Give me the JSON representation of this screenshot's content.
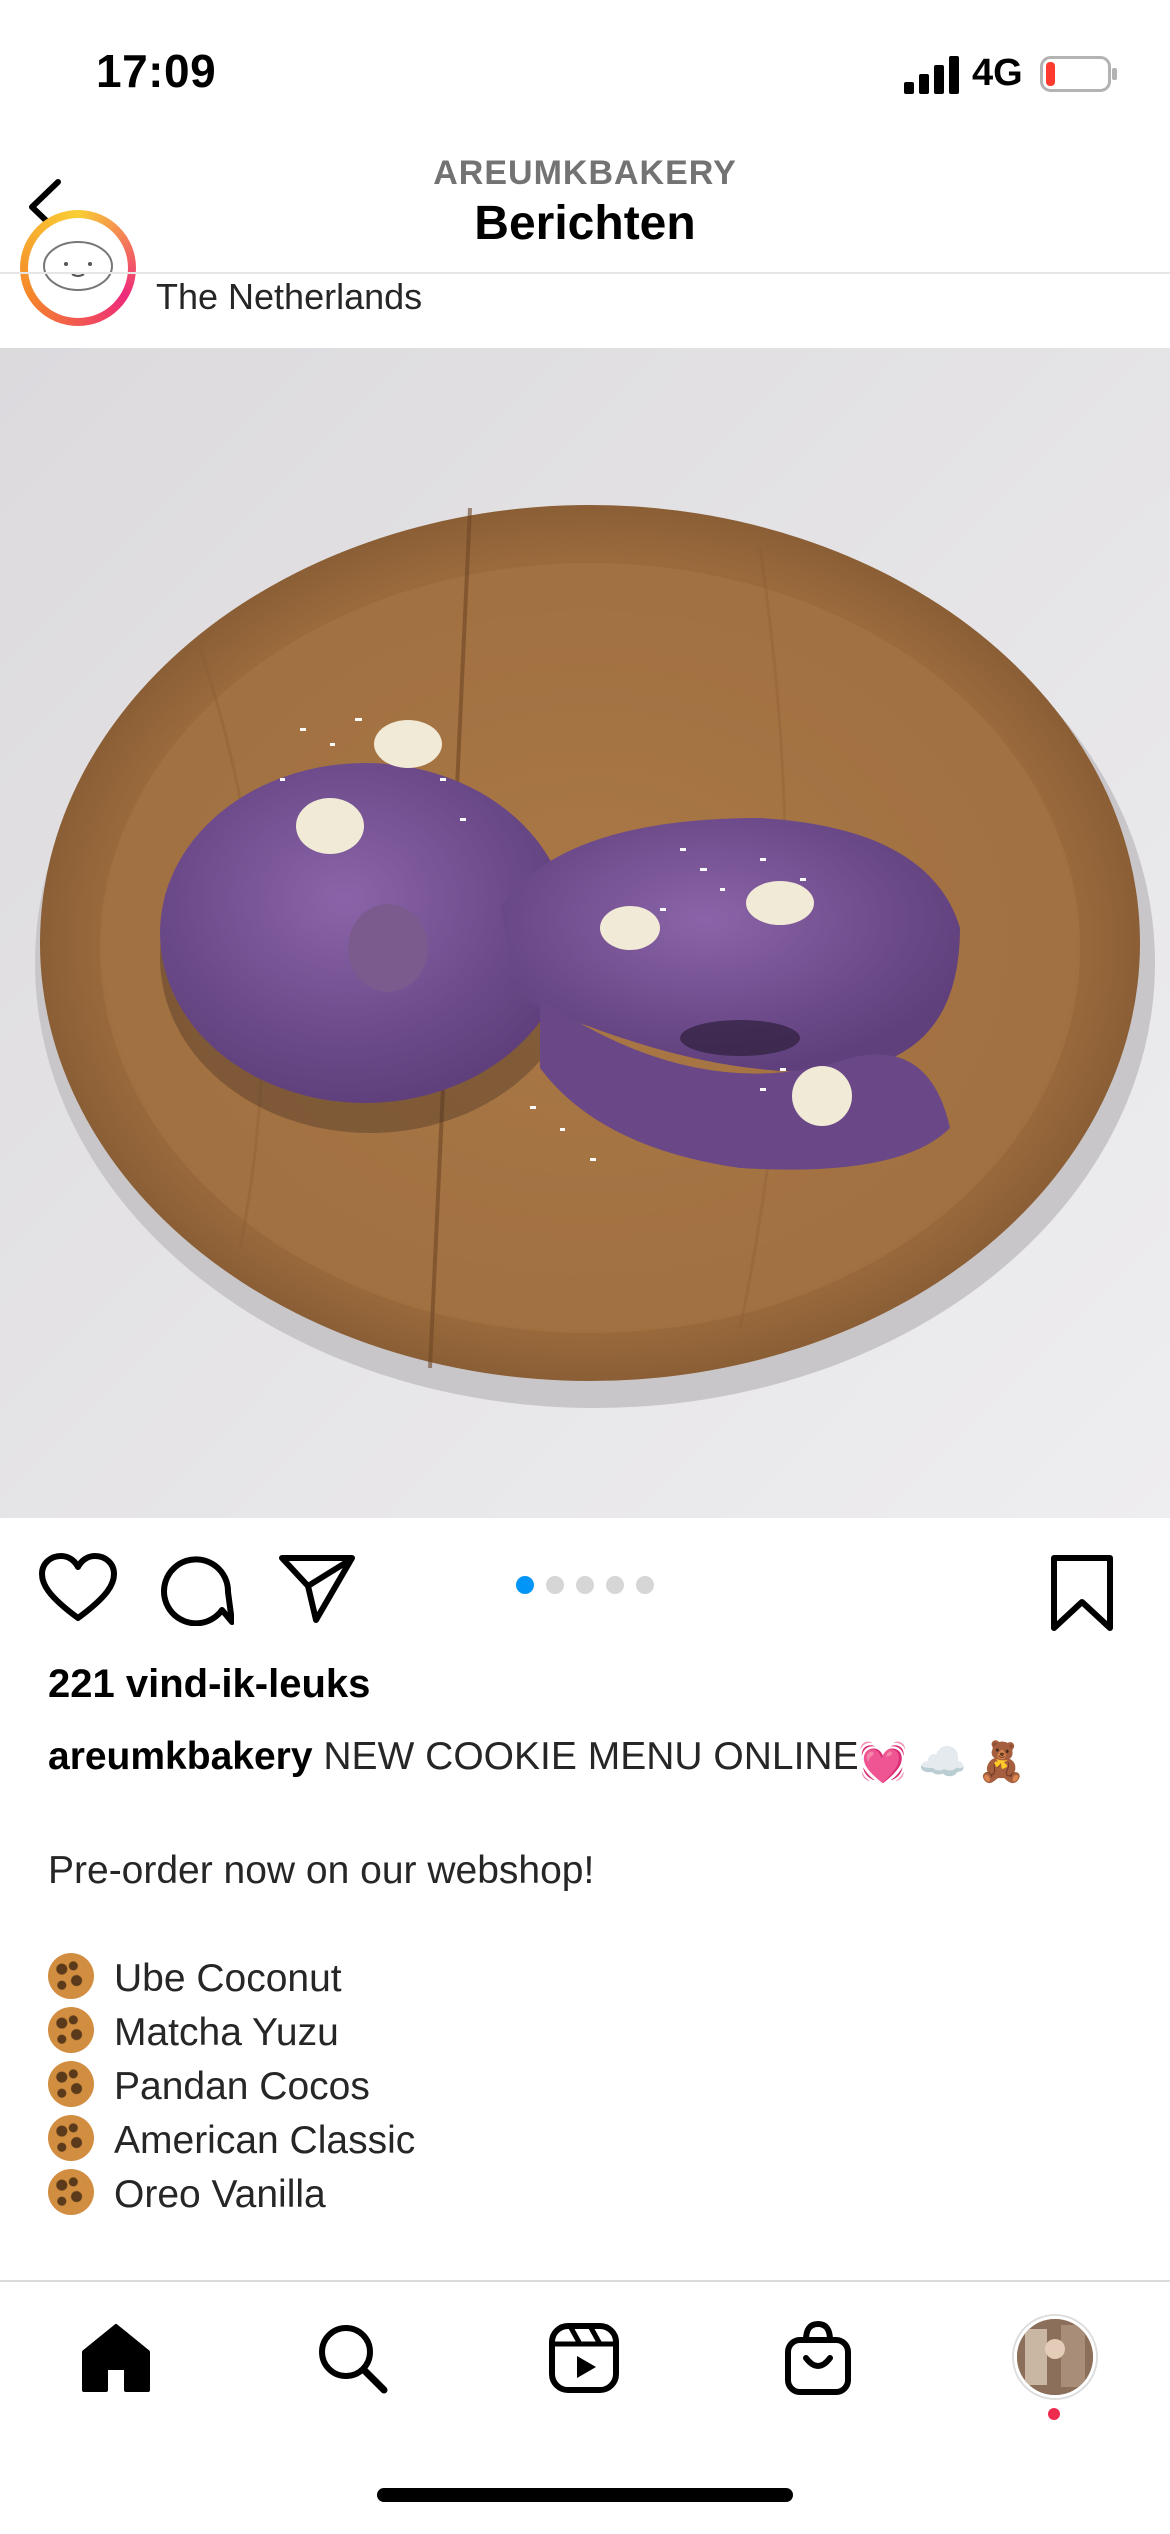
{
  "status_bar": {
    "time": "17:09",
    "network": "4G",
    "battery_level": 0.15
  },
  "nav": {
    "subtitle": "AREUMKBAKERY",
    "title": "Berichten"
  },
  "post": {
    "location": "The Netherlands",
    "carousel": {
      "count": 5,
      "active_index": 0
    },
    "likes": "221 vind-ik-leuks",
    "caption": {
      "username": "areumkbakery",
      "headline": "NEW COOKIE MENU ONLINE",
      "headline_emojis": [
        "💓",
        "☁️",
        "🧸"
      ],
      "preorder": "Pre-order now on our webshop!",
      "menu": [
        "Ube Coconut",
        "Matcha Yuzu",
        "Pandan Cocos",
        "American Classic",
        "Oreo Vanilla"
      ]
    }
  },
  "tabbar": {
    "items": [
      "home",
      "search",
      "reels",
      "shop",
      "profile"
    ],
    "active": "home"
  },
  "colors": {
    "accent": "#0095f6",
    "notification": "#ed2c4f",
    "battery_low": "#ff3b30"
  }
}
